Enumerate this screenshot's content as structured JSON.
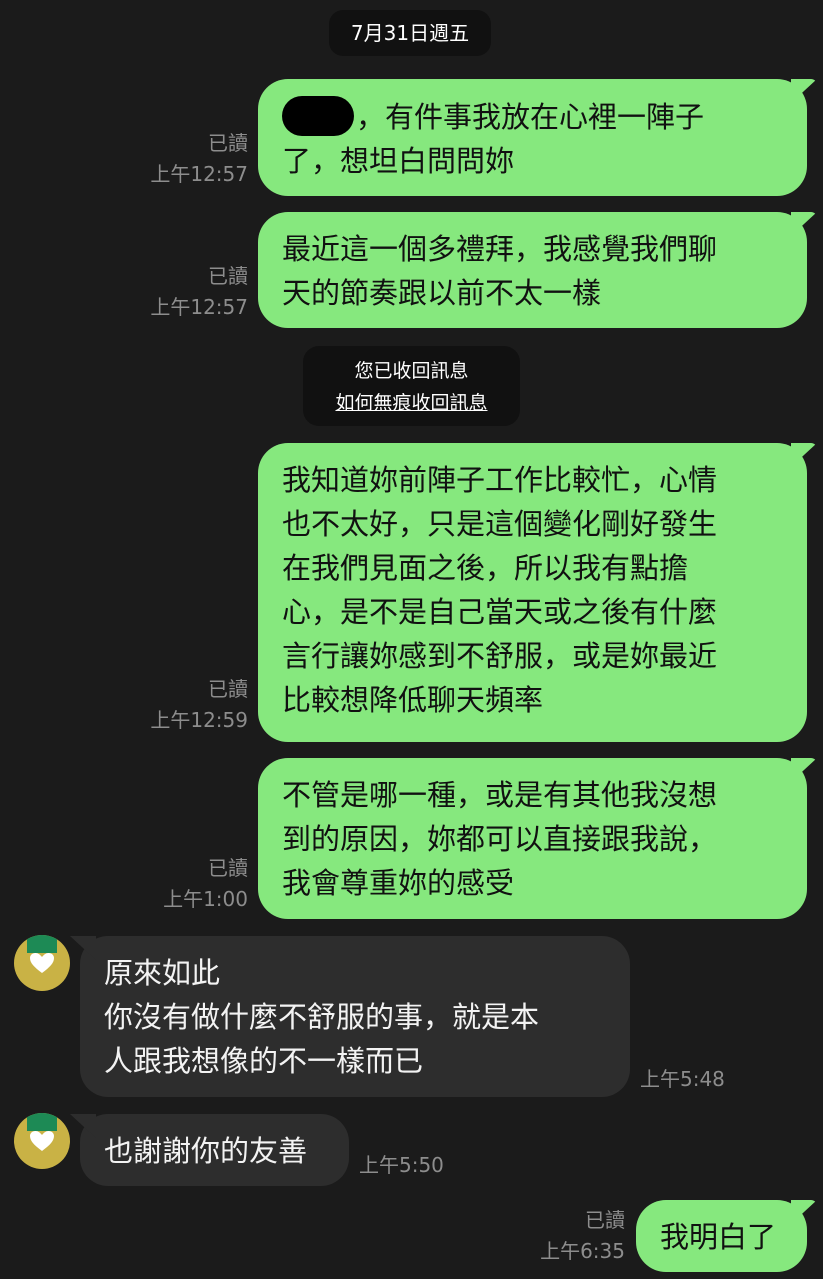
{
  "date_divider": "7月31日週五",
  "recall_notice": {
    "text": "您已收回訊息",
    "link": "如何無痕收回訊息"
  },
  "messages": [
    {
      "direction": "outgoing",
      "lines": [
        "，有件事我放在心裡一陣子",
        "了，想坦白問問妳"
      ],
      "redacted_name": true,
      "read_label": "已讀",
      "time": "上午12:57"
    },
    {
      "direction": "outgoing",
      "lines": [
        "最近這一個多禮拜，我感覺我們聊",
        "天的節奏跟以前不太一樣"
      ],
      "read_label": "已讀",
      "time": "上午12:57"
    },
    {
      "direction": "outgoing",
      "lines": [
        "我知道妳前陣子工作比較忙，心情",
        "也不太好，只是這個變化剛好發生",
        "在我們見面之後，所以我有點擔",
        "心，是不是自己當天或之後有什麼",
        "言行讓妳感到不舒服，或是妳最近",
        "比較想降低聊天頻率"
      ],
      "read_label": "已讀",
      "time": "上午12:59"
    },
    {
      "direction": "outgoing",
      "lines": [
        "不管是哪一種，或是有其他我沒想",
        "到的原因，妳都可以直接跟我說，",
        "我會尊重妳的感受"
      ],
      "read_label": "已讀",
      "time": "上午1:00"
    },
    {
      "direction": "incoming",
      "lines": [
        "原來如此",
        "你沒有做什麼不舒服的事，就是本",
        "人跟我想像的不一樣而已"
      ],
      "time": "上午5:48"
    },
    {
      "direction": "incoming",
      "lines": [
        "也謝謝你的友善"
      ],
      "time": "上午5:50"
    },
    {
      "direction": "outgoing",
      "lines": [
        "我明白了"
      ],
      "read_label": "已讀",
      "time": "上午6:35"
    }
  ],
  "colors": {
    "background": "#1b1b1b",
    "outgoing_bubble": "#86e87e",
    "incoming_bubble": "#2d2d2d",
    "meta_text": "#8d8d8d"
  },
  "icons": {
    "avatar": "contact-avatar"
  }
}
